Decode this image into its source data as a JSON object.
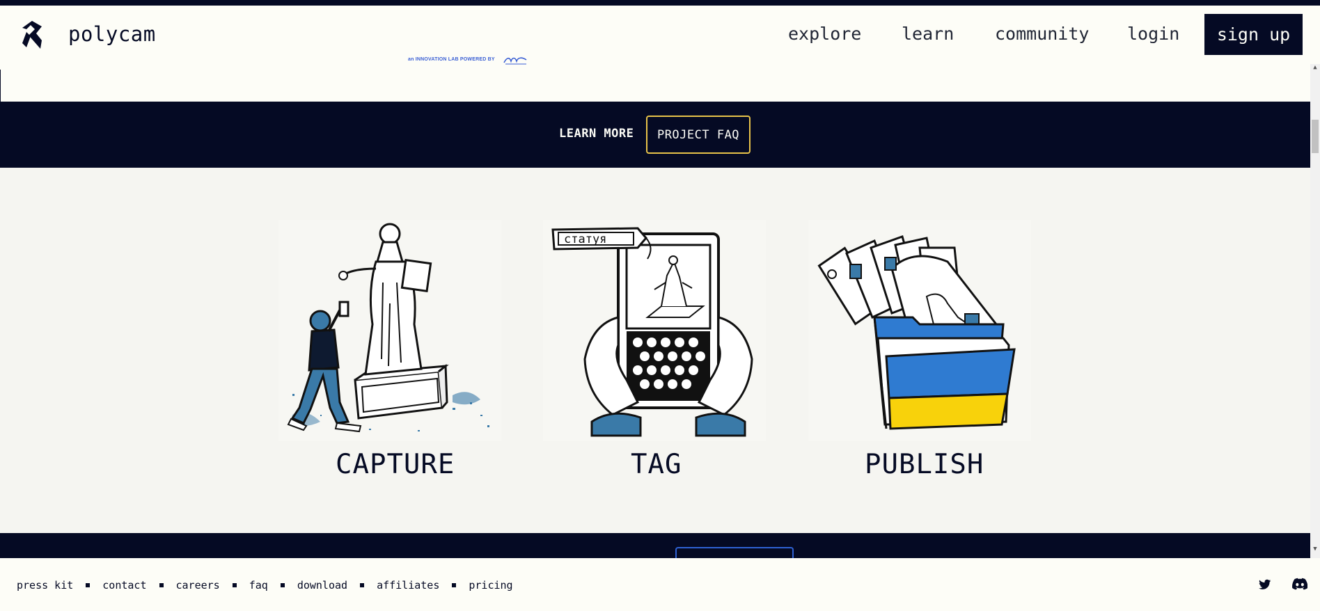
{
  "brand": {
    "name": "polycam"
  },
  "nav": {
    "explore": "explore",
    "learn": "learn",
    "community": "community",
    "login": "login",
    "signup": "sign up"
  },
  "partner": {
    "text": "an INNOVATION LAB POWERED BY"
  },
  "band": {
    "learn_more": "LEARN MORE",
    "faq_button": "PROJECT FAQ"
  },
  "steps": [
    {
      "label": "CAPTURE",
      "illustration": "person-photographing-statue"
    },
    {
      "label": "TAG",
      "illustration": "hands-holding-phone-with-tag",
      "tag_text": "статуя"
    },
    {
      "label": "PUBLISH",
      "illustration": "tags-in-ukraine-flag-folder"
    }
  ],
  "footer": {
    "links": [
      "press kit",
      "contact",
      "careers",
      "faq",
      "download",
      "affiliates",
      "pricing"
    ],
    "icons": [
      "twitter-icon",
      "discord-icon"
    ]
  },
  "colors": {
    "navy": "#050a24",
    "cream": "#fdfdf7",
    "gold": "#e8c34a",
    "blue": "#2f62d4",
    "flag_blue": "#2f7bd1",
    "flag_yellow": "#f8d20b"
  }
}
